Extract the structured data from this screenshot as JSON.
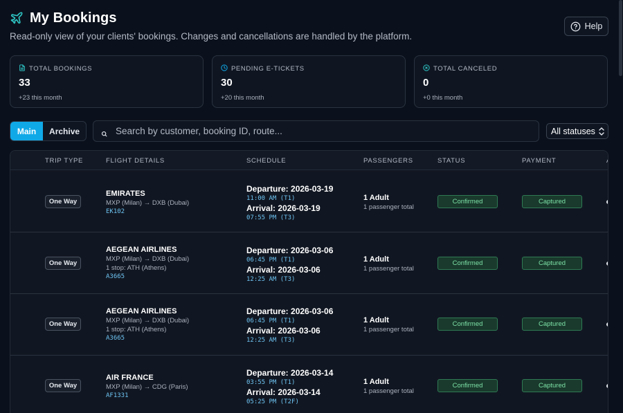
{
  "header": {
    "title": "My Bookings",
    "subtitle": "Read-only view of your clients' bookings. Changes and cancellations are handled by the platform.",
    "help_label": "Help"
  },
  "stats": [
    {
      "label": "TOTAL BOOKINGS",
      "value": "33",
      "sub": "+23 this month",
      "icon": "document-icon"
    },
    {
      "label": "PENDING E-TICKETS",
      "value": "30",
      "sub": "+20 this month",
      "icon": "clock-icon"
    },
    {
      "label": "TOTAL CANCELED",
      "value": "0",
      "sub": "+0 this month",
      "icon": "x-circle-icon"
    }
  ],
  "toolbar": {
    "tabs": [
      "Main",
      "Archive"
    ],
    "active_tab": "Main",
    "search_placeholder": "Search by customer, booking ID, route...",
    "status_filter": "All statuses"
  },
  "table": {
    "columns": [
      "TRIP TYPE",
      "FLIGHT DETAILS",
      "SCHEDULE",
      "PASSENGERS",
      "STATUS",
      "PAYMENT",
      "A"
    ],
    "rows": [
      {
        "trip_type": "One Way",
        "airline": "EMIRATES",
        "route": "MXP (Milan) → DXB (Dubai)",
        "stops": "",
        "flight_no": "EK102",
        "departure": "Departure: 2026-03-19",
        "departure_time": "11:00 AM (T1)",
        "arrival": "Arrival: 2026-03-19",
        "arrival_time": "07:55 PM (T3)",
        "passengers": "1 Adult",
        "passengers_total": "1 passenger total",
        "status": "Confirmed",
        "payment": "Captured"
      },
      {
        "trip_type": "One Way",
        "airline": "AEGEAN AIRLINES",
        "route": "MXP (Milan) → DXB (Dubai)",
        "stops": "1 stop: ATH (Athens)",
        "flight_no": "A3665",
        "departure": "Departure: 2026-03-06",
        "departure_time": "06:45 PM (T1)",
        "arrival": "Arrival: 2026-03-06",
        "arrival_time": "12:25 AM (T3)",
        "passengers": "1 Adult",
        "passengers_total": "1 passenger total",
        "status": "Confirmed",
        "payment": "Captured"
      },
      {
        "trip_type": "One Way",
        "airline": "AEGEAN AIRLINES",
        "route": "MXP (Milan) → DXB (Dubai)",
        "stops": "1 stop: ATH (Athens)",
        "flight_no": "A3665",
        "departure": "Departure: 2026-03-06",
        "departure_time": "06:45 PM (T1)",
        "arrival": "Arrival: 2026-03-06",
        "arrival_time": "12:25 AM (T3)",
        "passengers": "1 Adult",
        "passengers_total": "1 passenger total",
        "status": "Confirmed",
        "payment": "Captured"
      },
      {
        "trip_type": "One Way",
        "airline": "AIR FRANCE",
        "route": "MXP (Milan) → CDG (Paris)",
        "stops": "",
        "flight_no": "AF1331",
        "departure": "Departure: 2026-03-14",
        "departure_time": "03:55 PM (T1)",
        "arrival": "Arrival: 2026-03-14",
        "arrival_time": "05:25 PM (T2F)",
        "passengers": "1 Adult",
        "passengers_total": "1 passenger total",
        "status": "Confirmed",
        "payment": "Captured"
      }
    ]
  },
  "colors": {
    "accent": "#10a9e8",
    "background": "#0b111c",
    "card": "#0f1622",
    "status_green_text": "#7ee2a8",
    "status_green_bg": "#193a2c",
    "mono_blue": "#6ec3f2"
  }
}
